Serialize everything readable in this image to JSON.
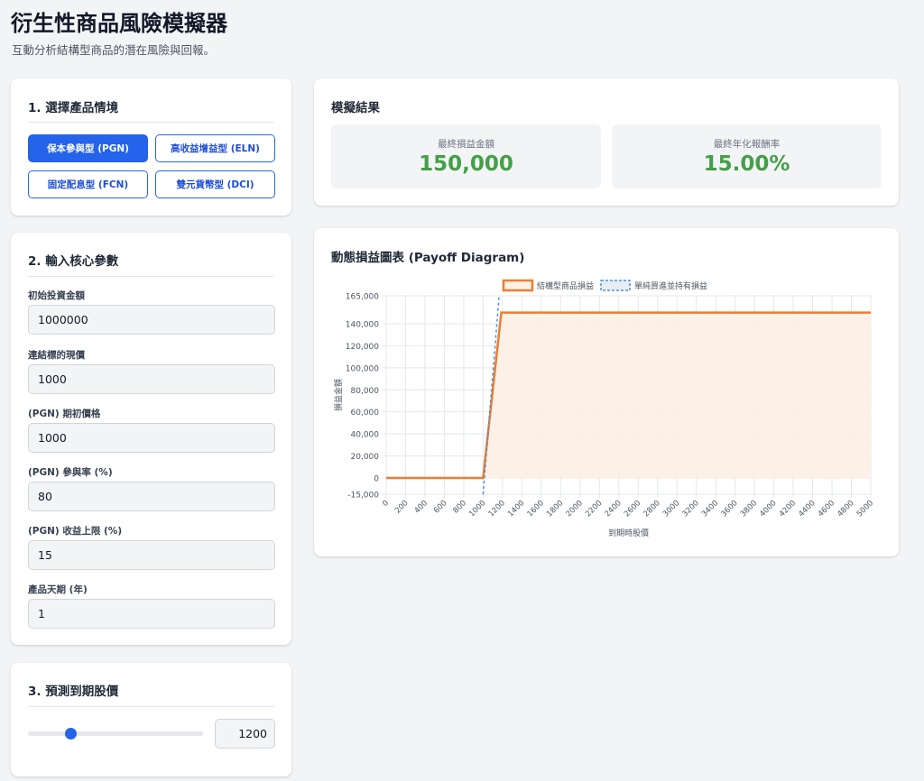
{
  "header": {
    "title": "衍生性商品風險模擬器",
    "subtitle": "互動分析結構型商品的潛在風險與回報。"
  },
  "scenario_panel": {
    "title": "1. 選擇產品情境",
    "buttons": [
      {
        "label": "保本參與型 (PGN)",
        "active": true
      },
      {
        "label": "高收益增益型 (ELN)",
        "active": false
      },
      {
        "label": "固定配息型 (FCN)",
        "active": false
      },
      {
        "label": "雙元貨幣型 (DCI)",
        "active": false
      }
    ]
  },
  "params_panel": {
    "title": "2. 輸入核心參數",
    "fields": [
      {
        "label": "初始投資金額",
        "value": "1000000"
      },
      {
        "label": "連結標的現價",
        "value": "1000"
      },
      {
        "label": "(PGN) 期初價格",
        "value": "1000"
      },
      {
        "label": "(PGN) 參與率 (%)",
        "value": "80"
      },
      {
        "label": "(PGN) 收益上限 (%)",
        "value": "15"
      },
      {
        "label": "產品天期 (年)",
        "value": "1"
      }
    ]
  },
  "forecast_panel": {
    "title": "3. 預測到期股價",
    "slider_value": 1200,
    "slider_min": 0,
    "slider_max": 5000,
    "input_value": "1200"
  },
  "results_panel": {
    "title": "模擬結果",
    "final_pnl_label": "最終損益金額",
    "final_pnl_value": "150,000",
    "annualized_label": "最終年化報酬率",
    "annualized_value": "15.00%",
    "value_color": "#43a047"
  },
  "chart_panel": {
    "title": "動態損益圖表 (Payoff Diagram)"
  },
  "chart_data": {
    "type": "line",
    "xlabel": "到期時股價",
    "ylabel": "損益金額",
    "xlim": [
      0,
      5000
    ],
    "ylim": [
      -15000,
      165000
    ],
    "x_ticks": [
      "0",
      "200",
      "400",
      "600",
      "800",
      "1000",
      "1200",
      "1400",
      "1600",
      "1800",
      "2000",
      "2200",
      "2400",
      "2600",
      "2800",
      "3000",
      "3200",
      "3400",
      "3600",
      "3800",
      "4000",
      "4200",
      "4400",
      "4600",
      "4800",
      "5000"
    ],
    "y_ticks": [
      "165,000",
      "140,000",
      "120,000",
      "100,000",
      "80,000",
      "60,000",
      "40,000",
      "20,000",
      "0",
      "-15,000"
    ],
    "legend_position": "top",
    "grid": true,
    "series": [
      {
        "name": "結構型商品損益",
        "color": "#ed7d31",
        "fill": "#fdf0e4",
        "style": "solid",
        "points": [
          [
            0,
            0
          ],
          [
            1000,
            0
          ],
          [
            1187.5,
            150000
          ],
          [
            5000,
            150000
          ]
        ]
      },
      {
        "name": "單純買進並持有損益",
        "color": "#4a90d9",
        "style": "dashed",
        "points": [
          [
            1000,
            -15000
          ],
          [
            1165,
            165000
          ]
        ]
      }
    ]
  }
}
